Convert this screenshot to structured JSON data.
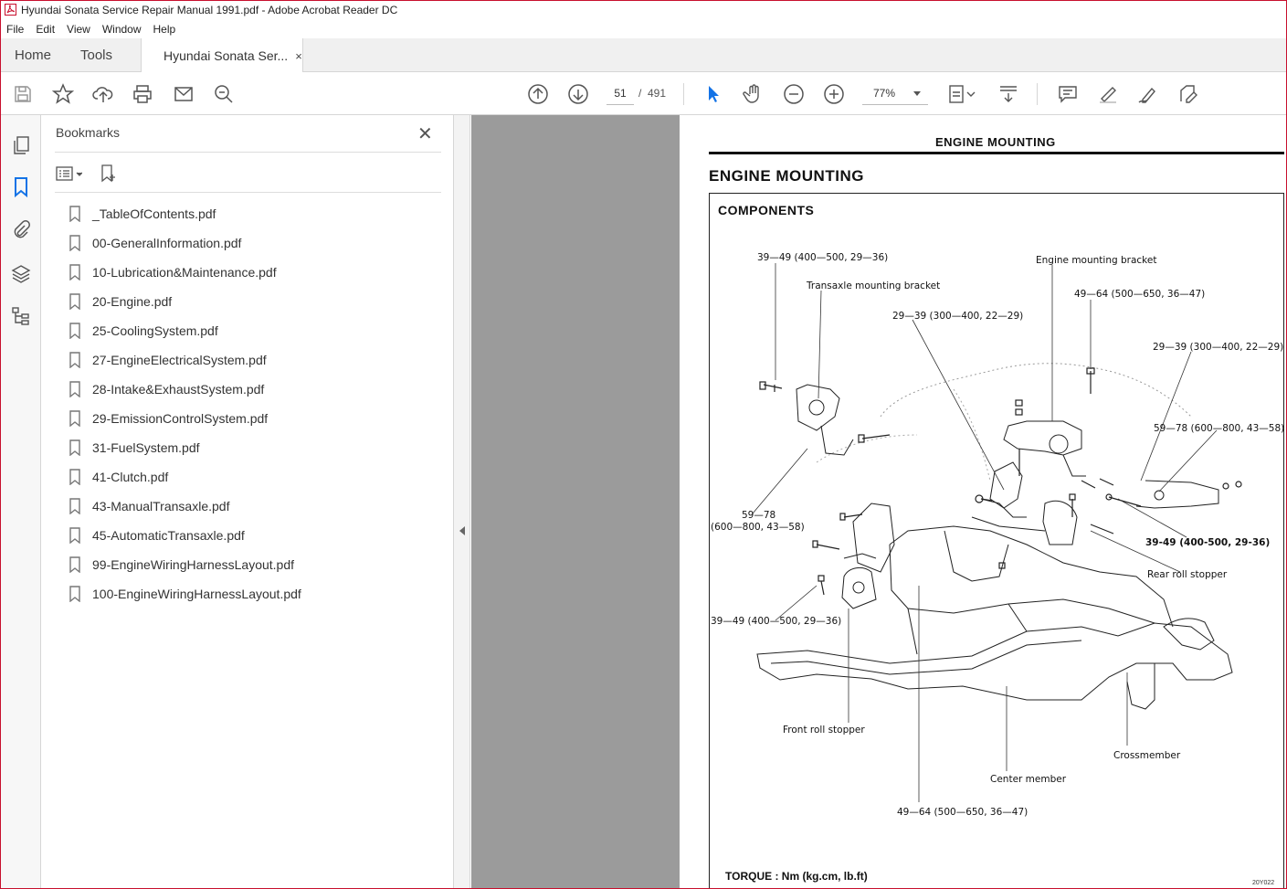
{
  "window": {
    "title": "Hyundai Sonata Service Repair Manual 1991.pdf - Adobe Acrobat Reader DC"
  },
  "menu": [
    "File",
    "Edit",
    "View",
    "Window",
    "Help"
  ],
  "tabs": {
    "home": "Home",
    "tools": "Tools",
    "document": "Hyundai Sonata Ser...",
    "close": "×"
  },
  "toolbar": {
    "page_current": "51",
    "page_separator": "/",
    "page_total": "491",
    "zoom": "77%"
  },
  "bookmarks": {
    "title": "Bookmarks",
    "close": "✕",
    "items": [
      "_TableOfContents.pdf",
      "00-GeneralInformation.pdf",
      "10-Lubrication&Maintenance.pdf",
      "20-Engine.pdf",
      "25-CoolingSystem.pdf",
      "27-EngineElectricalSystem.pdf",
      "28-Intake&ExhaustSystem.pdf",
      "29-EmissionControlSystem.pdf",
      "31-FuelSystem.pdf",
      "41-Clutch.pdf",
      "43-ManualTransaxle.pdf",
      "45-AutomaticTransaxle.pdf",
      "99-EngineWiringHarnessLayout.pdf",
      "100-EngineWiringHarnessLayout.pdf"
    ]
  },
  "document": {
    "header": "ENGINE MOUNTING",
    "title": "ENGINE MOUNTING",
    "section": "COMPONENTS",
    "labels": {
      "l1": "39—49 (400—500, 29—36)",
      "l2": "Transaxle mounting bracket",
      "l3": "Engine mounting bracket",
      "l4": "49—64 (500—650, 36—47)",
      "l5": "29—39 (300—400, 22—29)",
      "l6": "29—39 (300—400, 22—29)",
      "l7": "59—78 (600—800, 43—58)",
      "l8a": "59—78",
      "l8b": "(600—800, 43—58)",
      "l9": "39-49 (400-500, 29-36)",
      "l10": "Rear roll stopper",
      "l11": "39—49 (400—500, 29—36)",
      "l12": "Front roll stopper",
      "l13": "Crossmember",
      "l14": "Center member",
      "l15": "49—64 (500—650, 36—47)"
    },
    "torque_note": "TORQUE : Nm (kg.cm, lb.ft)",
    "figure_code": "20Y022"
  },
  "colors": {
    "accent_blue": "#1473e6",
    "page_gray": "#9b9b9b",
    "frame_red": "#c8102e"
  }
}
